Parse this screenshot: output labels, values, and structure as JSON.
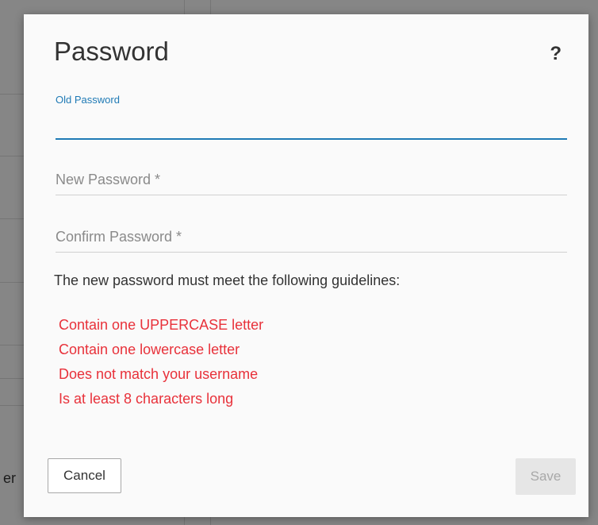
{
  "background": {
    "partial_text": "er"
  },
  "dialog": {
    "title": "Password",
    "help_label": "?",
    "fields": {
      "old_password": {
        "label": "Old Password",
        "value": ""
      },
      "new_password": {
        "placeholder": "New Password *",
        "value": ""
      },
      "confirm_password": {
        "placeholder": "Confirm Password *",
        "value": ""
      }
    },
    "guidelines_intro": "The new password must meet the following guidelines:",
    "guidelines": [
      "Contain one UPPERCASE letter",
      "Contain one lowercase letter",
      "Does not match your username",
      "Is at least 8 characters long"
    ],
    "guideline_color": "#e8313a",
    "accent_color": "#1f7ab5",
    "buttons": {
      "cancel": "Cancel",
      "save": "Save"
    }
  }
}
